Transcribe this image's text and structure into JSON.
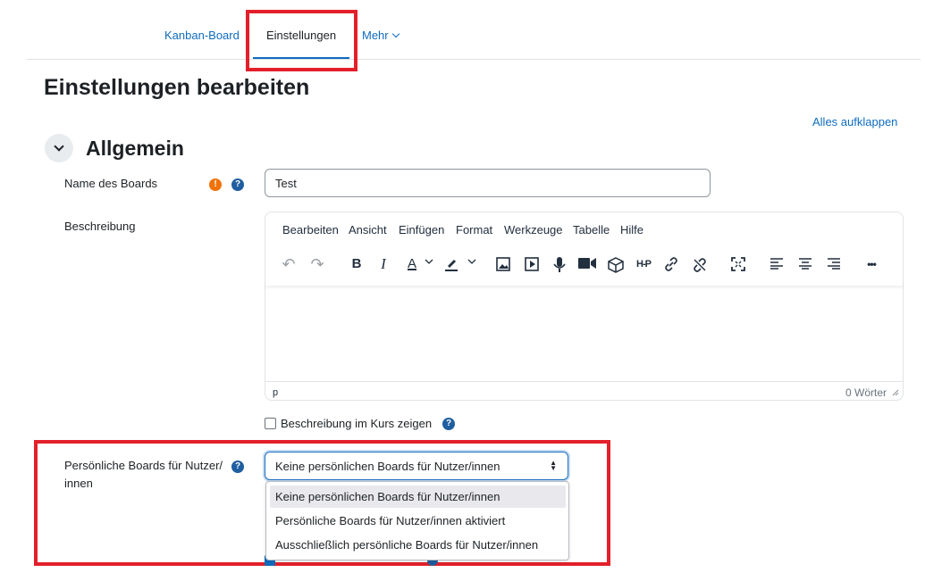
{
  "nav": {
    "tabs": [
      {
        "label": "Kanban-Board"
      },
      {
        "label": "Einstellungen"
      },
      {
        "label": "Mehr"
      }
    ]
  },
  "page": {
    "title": "Einstellungen bearbeiten",
    "expand_all": "Alles aufklappen"
  },
  "section": {
    "title": "Allgemein"
  },
  "form": {
    "name_label": "Name des Boards",
    "required_icon": "!",
    "help_icon": "?",
    "name_value": "Test",
    "description_label": "Beschreibung",
    "show_description_label": "Beschreibung im Kurs zeigen",
    "personal_label_line1": "Persönliche Boards für Nutzer/",
    "personal_label_line2": "innen",
    "personal_selected": "Keine persönlichen Boards für Nutzer/innen",
    "personal_options": [
      "Keine persönlichen Boards für Nutzer/innen",
      "Persönliche Boards für Nutzer/innen aktiviert",
      "Ausschließlich persönliche Boards für Nutzer/innen"
    ]
  },
  "editor": {
    "menu": [
      "Bearbeiten",
      "Ansicht",
      "Einfügen",
      "Format",
      "Werkzeuge",
      "Tabelle",
      "Hilfe"
    ],
    "toolbar": {
      "undo": "↶",
      "redo": "↷",
      "bold": "B",
      "italic": "I",
      "font_color": "A",
      "h5p": "H-P",
      "more": "•••"
    },
    "status_path": "p",
    "word_count": "0 Wörter"
  },
  "colors": {
    "link": "#0f6cbf",
    "highlight_box": "#e3202a",
    "required": "#f0730a",
    "help": "#1f5ea0"
  }
}
